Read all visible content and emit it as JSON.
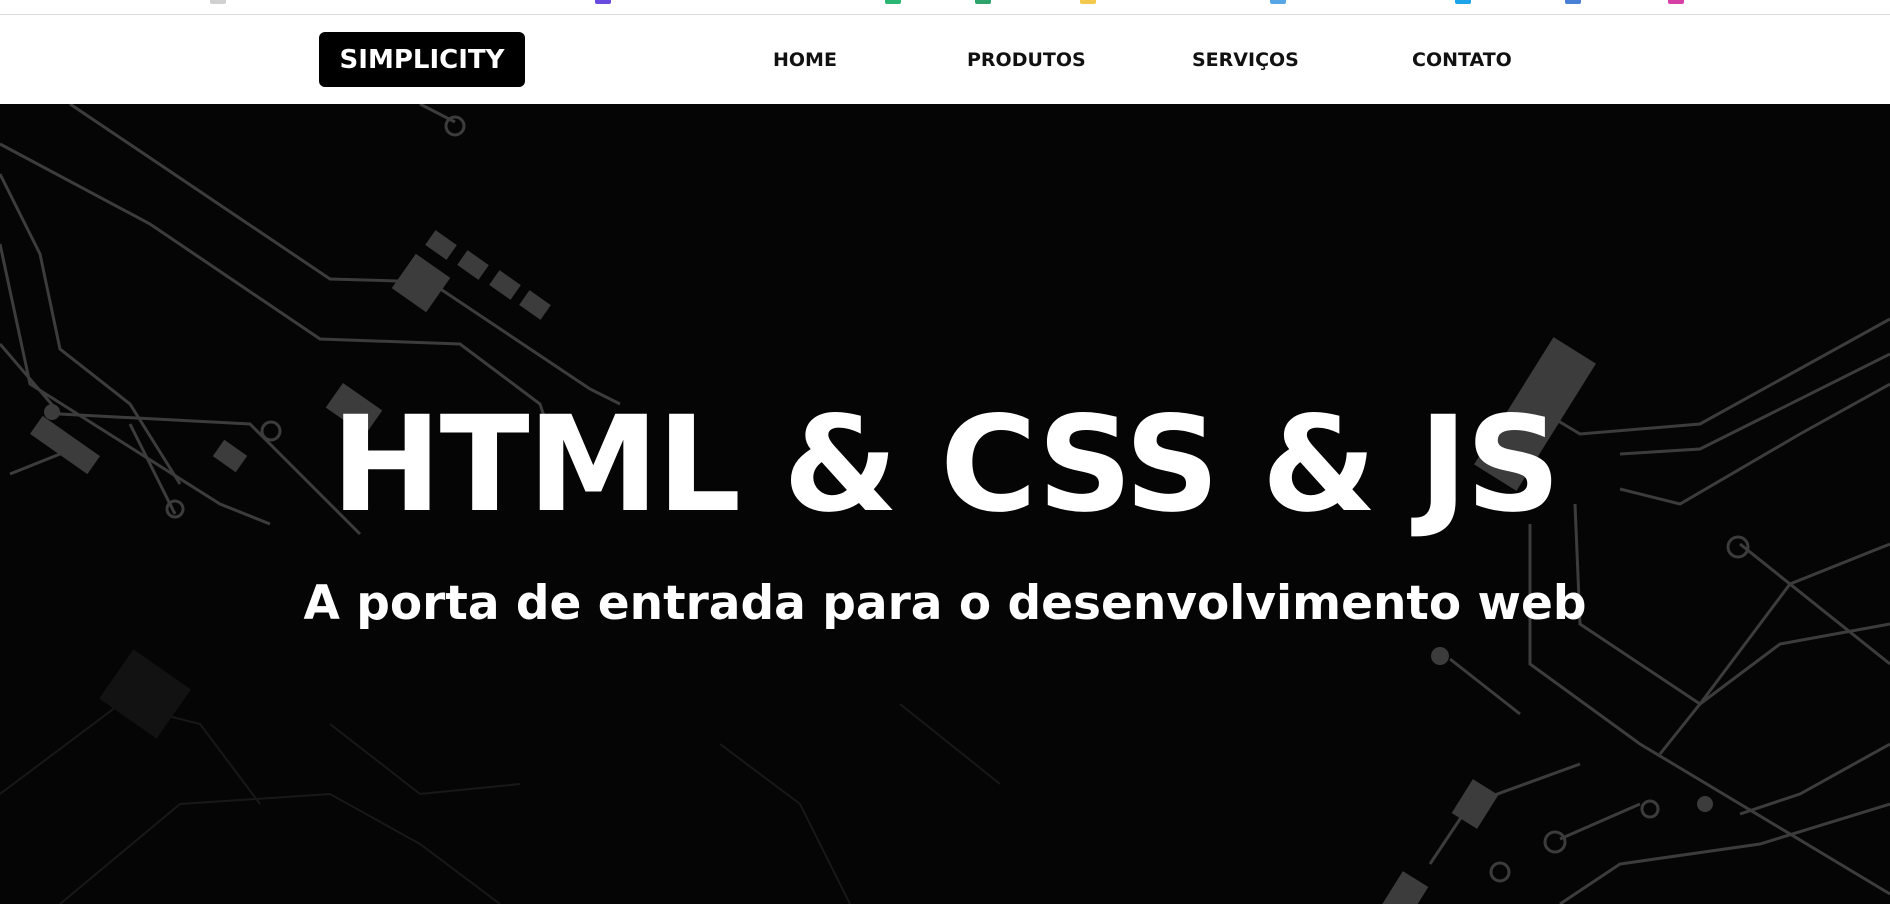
{
  "header": {
    "logo": "SIMPLICITY",
    "nav": [
      {
        "label": "HOME"
      },
      {
        "label": "PRODUTOS"
      },
      {
        "label": "SERVIÇOS"
      },
      {
        "label": "CONTATO"
      }
    ]
  },
  "hero": {
    "title": "HTML & CSS & JS",
    "subtitle": "A porta de entrada para o desenvolvimento web",
    "background": "circuit-board-pattern"
  },
  "colors": {
    "hero_bg": "#050505",
    "circuit": "#3f3f3f",
    "logo_bg": "#000000",
    "text_light": "#ffffff",
    "nav_text": "#111111"
  }
}
